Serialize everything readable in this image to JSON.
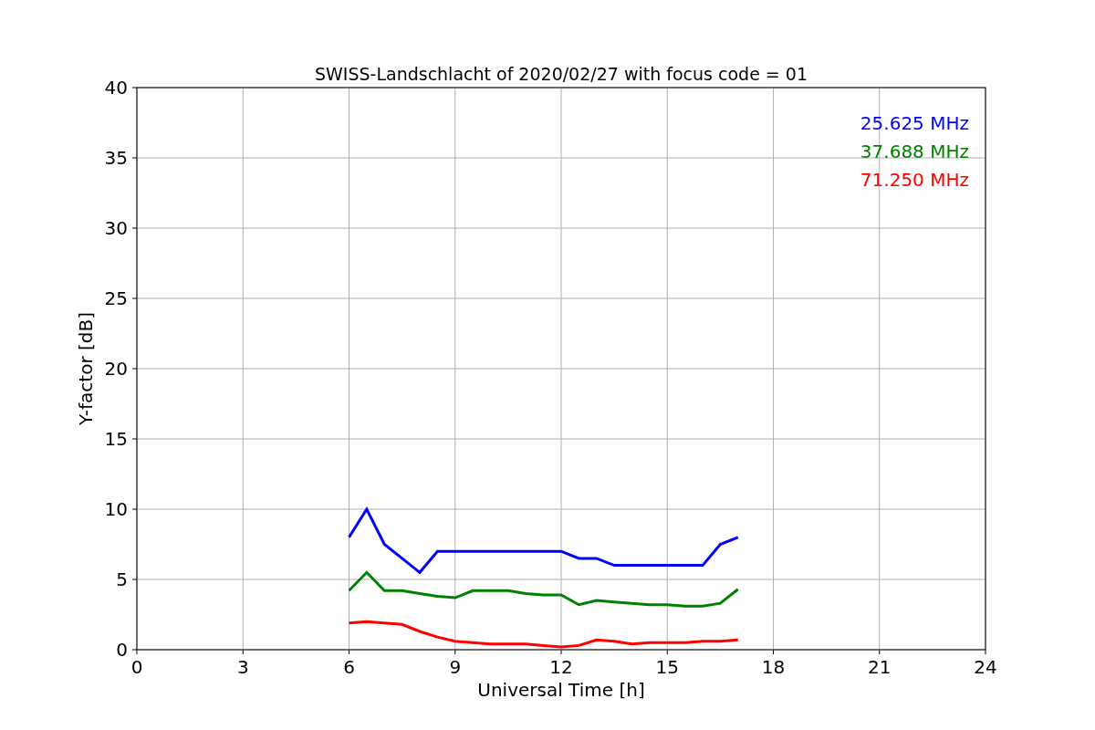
{
  "chart_data": {
    "type": "line",
    "title": "SWISS-Landschlacht of 2020/02/27 with focus code = 01",
    "xlabel": "Universal Time [h]",
    "ylabel": "Y-factor [dB]",
    "x": [
      6,
      6.5,
      7,
      7.5,
      8,
      8.5,
      9,
      9.5,
      10,
      10.5,
      11,
      11.5,
      12,
      12.5,
      13,
      13.5,
      14,
      14.5,
      15,
      15.5,
      16,
      16.5,
      17
    ],
    "series": [
      {
        "name": "25.625 MHz",
        "color": "#0000ff",
        "values": [
          8,
          10,
          7.5,
          6.5,
          5.5,
          7,
          7,
          7,
          7,
          7,
          7,
          7,
          7,
          6.5,
          6.5,
          6,
          6,
          6,
          6,
          6,
          6,
          7.5,
          8
        ]
      },
      {
        "name": "37.688 MHz",
        "color": "#008000",
        "values": [
          4.2,
          5.5,
          4.2,
          4.2,
          4,
          3.8,
          3.7,
          4.2,
          4.2,
          4.2,
          4,
          3.9,
          3.9,
          3.2,
          3.5,
          3.4,
          3.3,
          3.2,
          3.2,
          3.1,
          3.1,
          3.3,
          4.3
        ]
      },
      {
        "name": "71.250 MHz",
        "color": "#ff0000",
        "values": [
          1.9,
          2,
          1.9,
          1.8,
          1.3,
          0.9,
          0.6,
          0.5,
          0.4,
          0.4,
          0.4,
          0.3,
          0.2,
          0.3,
          0.7,
          0.6,
          0.4,
          0.5,
          0.5,
          0.5,
          0.6,
          0.6,
          0.7
        ]
      }
    ],
    "grid": true,
    "xlim": [
      0,
      24
    ],
    "ylim": [
      0,
      40
    ],
    "xticks": [
      0,
      3,
      6,
      9,
      12,
      15,
      18,
      21,
      24
    ],
    "yticks": [
      0,
      5,
      10,
      15,
      20,
      25,
      30,
      35,
      40
    ]
  }
}
